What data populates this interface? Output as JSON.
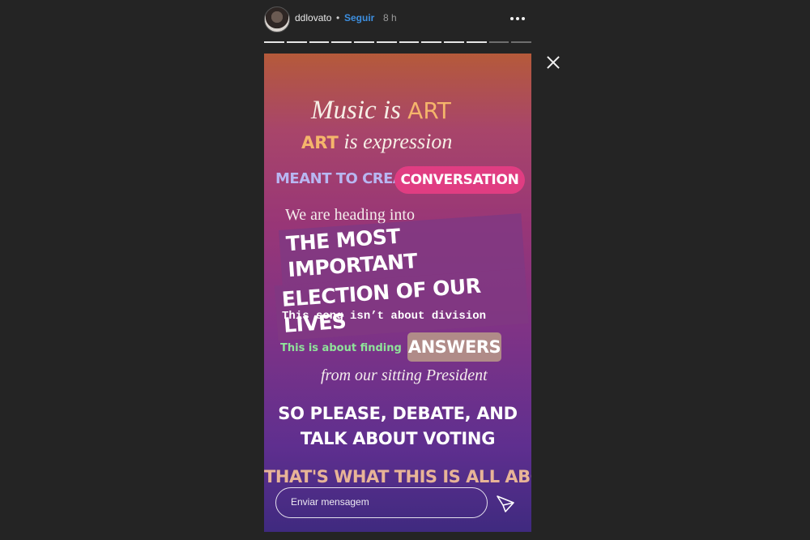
{
  "header": {
    "username": "ddlovato",
    "separator": "•",
    "follow_label": "Seguir",
    "time": "8 h",
    "avatar_icon": "avatar",
    "more_icon": "more-icon"
  },
  "progress": {
    "segments_total": 12,
    "segments_seen": 10
  },
  "close_icon": "close-icon",
  "story": {
    "line1_prefix": "Music is ",
    "line1_highlight": "ART",
    "line2_highlight": "ART",
    "line2_suffix": " is expression",
    "line3_left": "MEANT TO CREATE",
    "line3_pill": "CONVERSATION",
    "line4": "We are heading into",
    "big_line_a": "THE MOST IMPORTANT",
    "big_line_b": "ELECTION OF OUR LIVES",
    "line6": "This song isn’t about division",
    "line7_left": "This is about finding",
    "line7_pill": "ANSWERS",
    "line8": "from our sitting President",
    "line9": "SO PLEASE, DEBATE, AND",
    "line10": "TALK ABOUT VOTING",
    "line11": "THAT'S WHAT THIS IS ALL ABOUT"
  },
  "reply": {
    "placeholder": "Enviar mensagem",
    "send_icon": "send-icon"
  }
}
